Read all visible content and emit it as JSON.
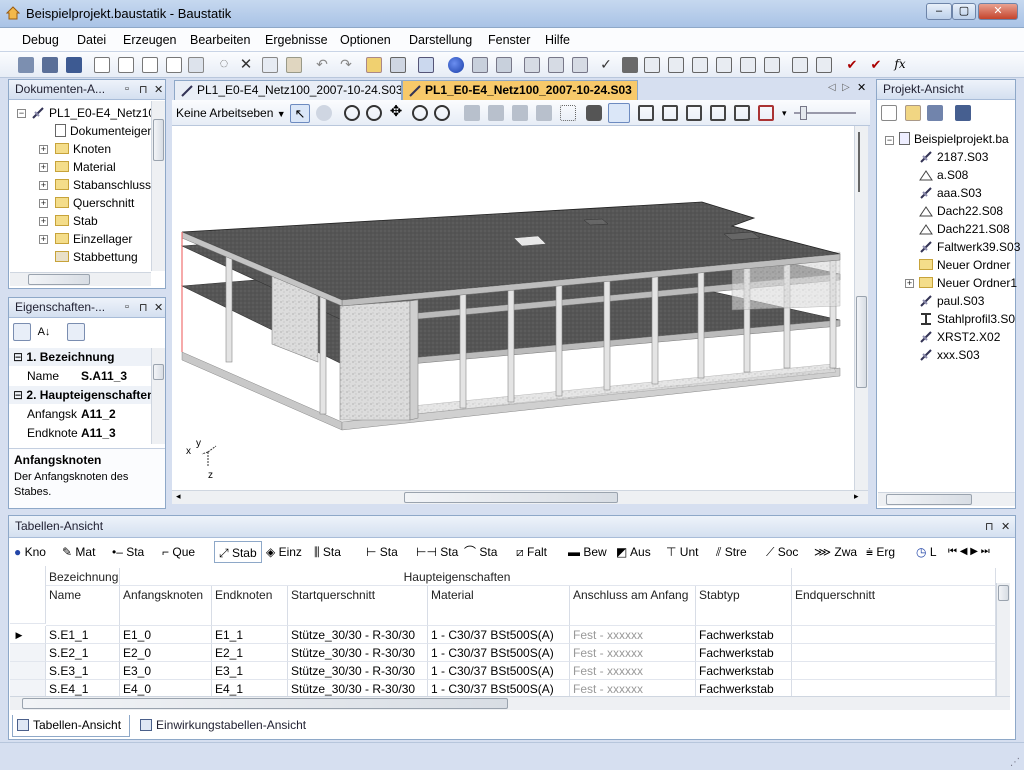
{
  "window": {
    "title": "Beispielprojekt.baustatik - Baustatik",
    "controls": [
      "–",
      "▢",
      "✕"
    ]
  },
  "menu": [
    "Debug",
    "Datei",
    "Erzeugen",
    "Bearbeiten",
    "Ergebnisse",
    "Optionen",
    "Darstellung",
    "Fenster",
    "Hilfe"
  ],
  "docs_panel": {
    "title": "Dokumenten-A...",
    "root": "PL1_E0-E4_Netz10",
    "items": [
      "Dokumenteigen",
      "Knoten",
      "Material",
      "Stabanschluss",
      "Querschnitt",
      "Stab",
      "Einzellager",
      "Stabbettung"
    ]
  },
  "props_panel": {
    "title": "Eigenschaften-...",
    "sections": [
      {
        "label": "1. Bezeichnung",
        "rows": [
          {
            "name": "Name",
            "value": "S.A11_3"
          }
        ]
      },
      {
        "label": "2. Haupteigenschaften",
        "rows": [
          {
            "name": "Anfangsk",
            "value": "A11_2"
          },
          {
            "name": "Endknote",
            "value": "A11_3"
          }
        ]
      }
    ],
    "help_title": "Anfangsknoten",
    "help_text": "Der Anfangsknoten des Stabes."
  },
  "doc_tabs": [
    {
      "label": "PL1_E0-E4_Netz100_2007-10-24.S03",
      "active": false
    },
    {
      "label": "PL1_E0-E4_Netz100_2007-10-24.S03",
      "active": true
    }
  ],
  "view": {
    "layer_select": "Keine Arbeitseben",
    "axes": {
      "x": "x",
      "y": "y",
      "z": "z"
    }
  },
  "project_panel": {
    "title": "Projekt-Ansicht",
    "root": "Beispielprojekt.ba",
    "items": [
      {
        "label": "2187.S03",
        "icon": "stab-icon"
      },
      {
        "label": "a.S08",
        "icon": "roof-icon"
      },
      {
        "label": "aaa.S03",
        "icon": "stab-icon"
      },
      {
        "label": "Dach22.S08",
        "icon": "roof-icon"
      },
      {
        "label": "Dach221.S08",
        "icon": "roof-icon"
      },
      {
        "label": "Faltwerk39.S03",
        "icon": "stab-icon"
      },
      {
        "label": "Neuer Ordner",
        "icon": "folder-icon"
      },
      {
        "label": "Neuer Ordner1",
        "icon": "folder-icon"
      },
      {
        "label": "paul.S03",
        "icon": "stab-icon"
      },
      {
        "label": "Stahlprofil3.S0",
        "icon": "beam-icon"
      },
      {
        "label": "XRST2.X02",
        "icon": "stab-icon"
      },
      {
        "label": "xxx.S03",
        "icon": "stab-icon"
      }
    ]
  },
  "table_panel": {
    "title": "Tabellen-Ansicht",
    "tools": [
      "Kno",
      "Mat",
      "Sta",
      "Que",
      "Stab",
      "Einz",
      "Sta",
      "Sta",
      "Sta",
      "Sta",
      "Falt",
      "Bew",
      "Aus",
      "Unt",
      "Stre",
      "Soc",
      "Zwa",
      "Erg",
      "L"
    ],
    "group_headers": {
      "first": "Bezeichnung",
      "main": "Haupteigenschaften"
    },
    "columns": [
      "Name",
      "Anfangsknoten",
      "Endknoten",
      "Startquerschnitt",
      "Material",
      "Anschluss am Anfang",
      "Stabtyp",
      "Endquerschnitt"
    ],
    "rows": [
      [
        "S.E1_1",
        "E1_0",
        "E1_1",
        "Stütze_30/30 - R-30/30",
        "1 - C30/37 BSt500S(A)",
        "Fest - xxxxxx",
        "Fachwerkstab",
        ""
      ],
      [
        "S.E2_1",
        "E2_0",
        "E2_1",
        "Stütze_30/30 - R-30/30",
        "1 - C30/37 BSt500S(A)",
        "Fest - xxxxxx",
        "Fachwerkstab",
        ""
      ],
      [
        "S.E3_1",
        "E3_0",
        "E3_1",
        "Stütze_30/30 - R-30/30",
        "1 - C30/37 BSt500S(A)",
        "Fest - xxxxxx",
        "Fachwerkstab",
        ""
      ],
      [
        "S.E4_1",
        "E4_0",
        "E4_1",
        "Stütze_30/30 - R-30/30",
        "1 - C30/37 BSt500S(A)",
        "Fest - xxxxxx",
        "Fachwerkstab",
        ""
      ]
    ],
    "bottom_tabs": [
      "Tabellen-Ansicht",
      "Einwirkungstabellen-Ansicht"
    ]
  },
  "colors": {
    "accent": "#f7c96a",
    "chrome": "#d6dff0",
    "slab": "#4a4a4a"
  }
}
